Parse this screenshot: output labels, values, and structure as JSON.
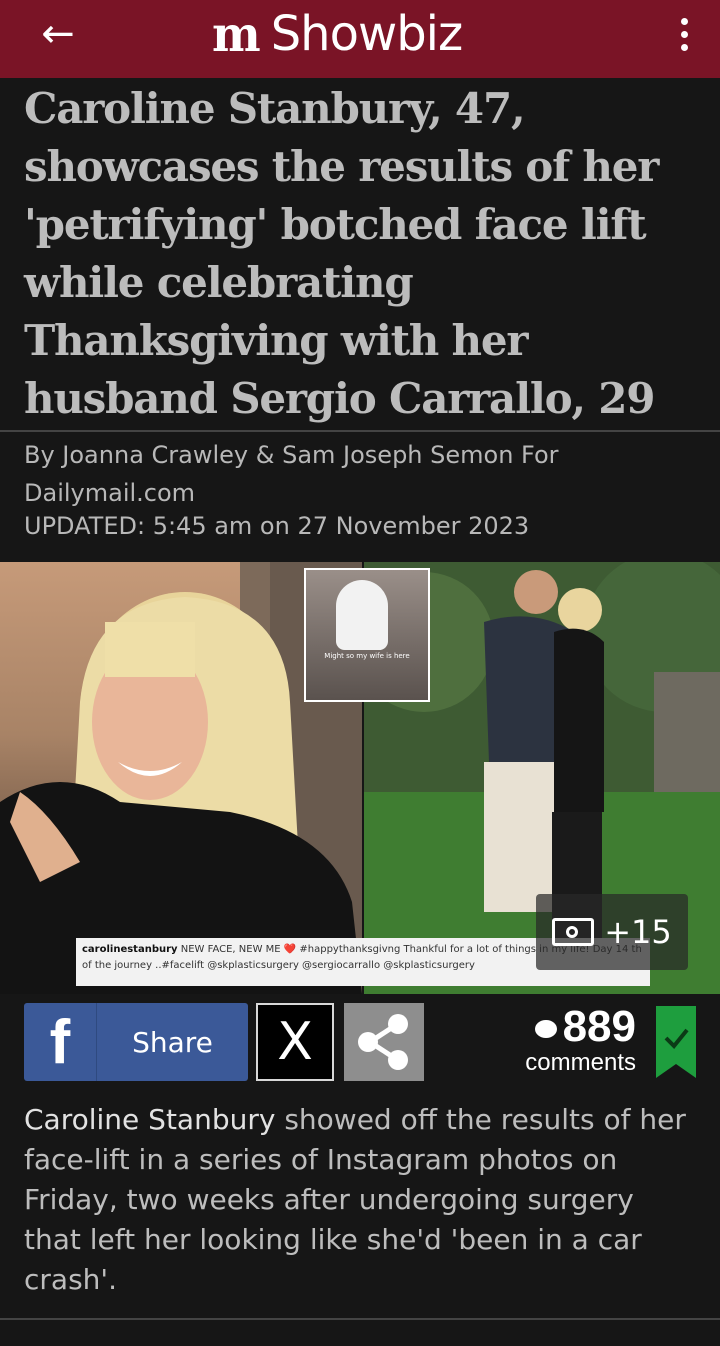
{
  "header": {
    "back_icon": "arrow-left-icon",
    "logo_mark": "m",
    "section_title": "Showbiz",
    "menu_icon": "vertical-dots-icon",
    "background": "#7a1426"
  },
  "article": {
    "headline": "Caroline Stanbury, 47, showcases the results of her 'petrifying' botched face lift while celebrating Thanksgiving with her husband Sergio Carrallo, 29",
    "byline": "By Joanna Crawley & Sam Joseph Semon For Dailymail.com",
    "updated_label": "UPDATED:",
    "updated_value": "5:45 am on 27 November 2023"
  },
  "hero": {
    "inset_caption": "Might so my wife is here",
    "caption_user": "carolinestanbury",
    "caption_text": "NEW FACE, NEW ME ❤️ #happythanksgivng Thankful for a lot of things in my life! Day 14 th of the journey ..#facelift @skplasticsurgery @sergiocarrallo @skplasticsurgery",
    "gallery_count": "+15"
  },
  "share_bar": {
    "facebook_label": "Share",
    "x_label": "X",
    "share_icon": "share-nodes-icon",
    "comments_count": "889",
    "comments_label": "comments",
    "bookmark_icon": "bookmark-check-icon"
  },
  "summary": {
    "subject": "Caroline Stanbury",
    "text": " showed off the results of her face-lift in a series of Instagram photos on Friday, two weeks after undergoing surgery that left her looking like she'd 'been in a car crash'."
  }
}
